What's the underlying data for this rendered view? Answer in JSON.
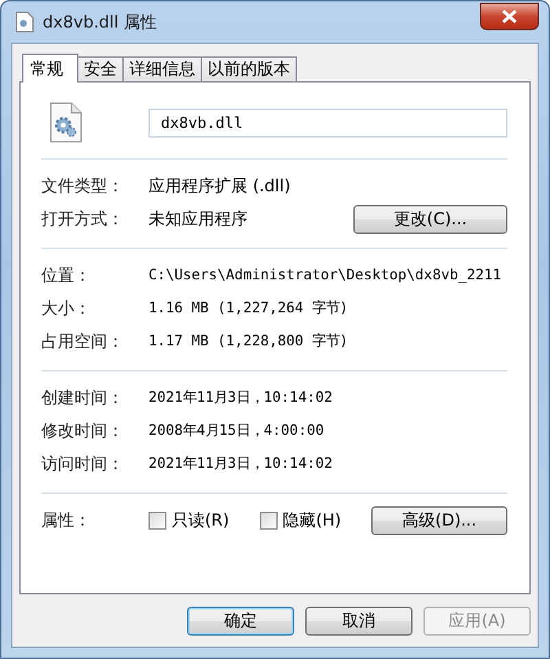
{
  "window": {
    "title": "dx8vb.dll 属性"
  },
  "tabs": [
    {
      "label": "常规",
      "selected": true
    },
    {
      "label": "安全",
      "selected": false
    },
    {
      "label": "详细信息",
      "selected": false
    },
    {
      "label": "以前的版本",
      "selected": false
    }
  ],
  "file_name": "dx8vb.dll",
  "sections": [
    [
      {
        "label": "文件类型：",
        "value": "应用程序扩展 (.dll)"
      },
      {
        "label": "打开方式：",
        "value": "未知应用程序",
        "button": "更改(C)..."
      }
    ],
    [
      {
        "label": "位置：",
        "value": "C:\\Users\\Administrator\\Desktop\\dx8vb_2211"
      },
      {
        "label": "大小：",
        "value": "1.16 MB (1,227,264 字节)"
      },
      {
        "label": "占用空间：",
        "value": "1.17 MB (1,228,800 字节)"
      }
    ],
    [
      {
        "label": "创建时间：",
        "value": "2021年11月3日，10:14:02"
      },
      {
        "label": "修改时间：",
        "value": "2008年4月15日，4:00:00"
      },
      {
        "label": "访问时间：",
        "value": "2021年11月3日，10:14:02"
      }
    ]
  ],
  "attributes": {
    "label": "属性：",
    "checkboxes": [
      {
        "label": "只读(R)",
        "checked": false
      },
      {
        "label": "隐藏(H)",
        "checked": false
      }
    ],
    "button": "高级(D)..."
  },
  "buttons": [
    {
      "label": "确定",
      "default": true,
      "disabled": false
    },
    {
      "label": "取消",
      "default": false,
      "disabled": false
    },
    {
      "label": "应用(A)",
      "default": false,
      "disabled": true
    }
  ]
}
